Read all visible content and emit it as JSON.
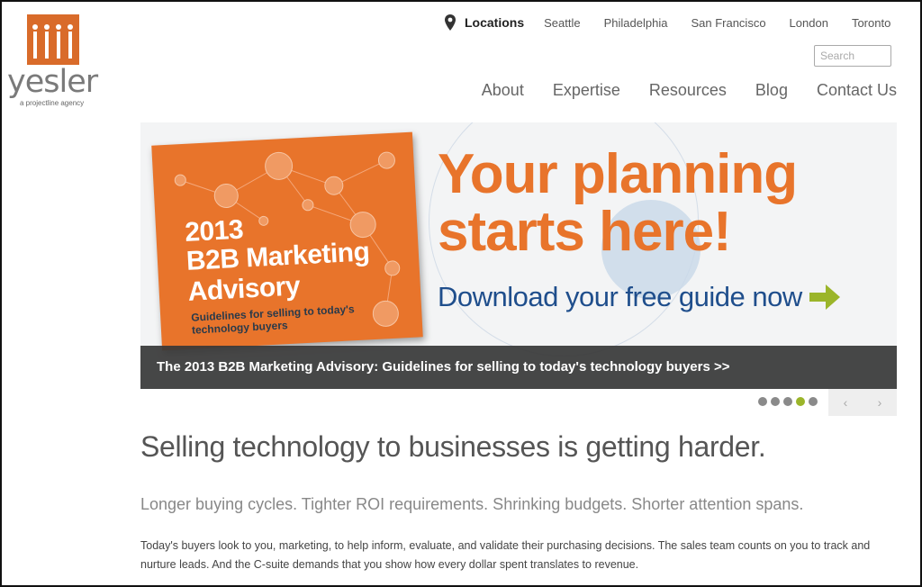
{
  "brand": {
    "name": "yesler",
    "tagline": "a projectline agency",
    "color": "#d96b2a"
  },
  "locations": {
    "label": "Locations",
    "cities": [
      "Seattle",
      "Philadelphia",
      "San Francisco",
      "London",
      "Toronto"
    ]
  },
  "search": {
    "placeholder": "Search"
  },
  "nav": {
    "items": [
      "About",
      "Expertise",
      "Resources",
      "Blog",
      "Contact Us"
    ]
  },
  "banner": {
    "book": {
      "year": "2013",
      "title": "B2B Marketing Advisory",
      "subtitle": "Guidelines for selling to today's technology buyers"
    },
    "headline": "Your planning starts here!",
    "cta": "Download your free guide now",
    "caption": "The 2013 B2B Marketing Advisory: Guidelines for selling to today's technology buyers >>",
    "accent_color": "#e8742b",
    "cta_color": "#1f4e8c"
  },
  "slider": {
    "slide_count": 5,
    "active_index": 3,
    "prev": "‹",
    "next": "›"
  },
  "content": {
    "heading": "Selling technology to businesses is getting harder.",
    "subheading": "Longer buying cycles. Tighter ROI requirements. Shrinking budgets. Shorter attention spans.",
    "paragraph": "Today's buyers look to you, marketing, to help inform, evaluate, and validate their purchasing decisions. The sales team counts on you to track and nurture leads. And the C-suite demands that you show how every dollar spent translates to revenue."
  }
}
